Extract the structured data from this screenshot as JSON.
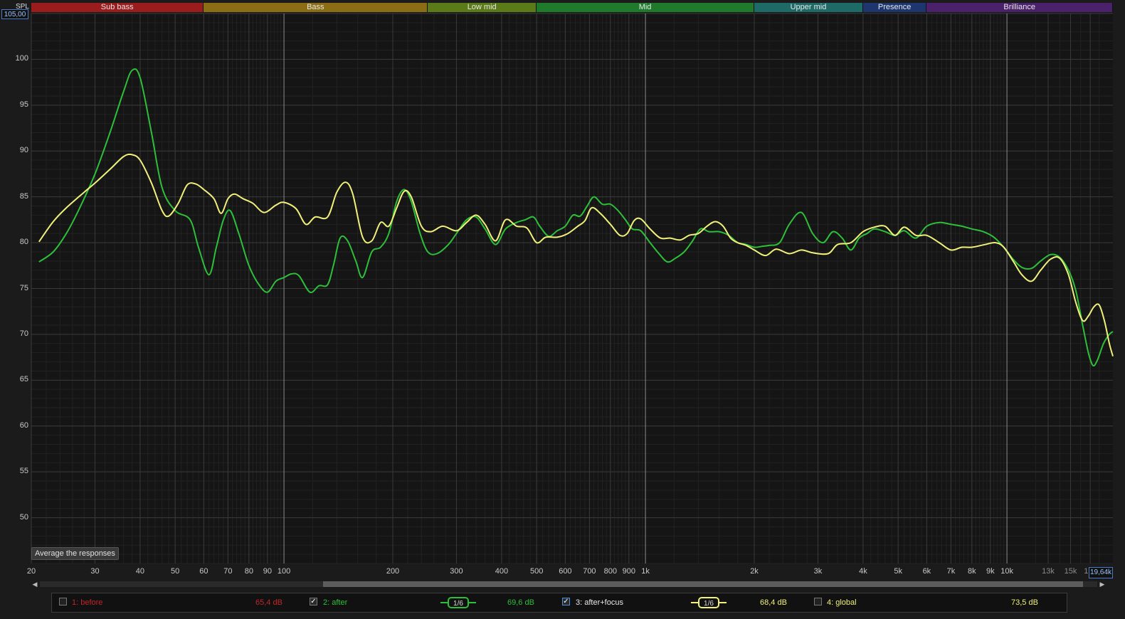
{
  "header": {
    "y_axis_label": "SPL",
    "y_max_value": "105,00"
  },
  "bands": [
    {
      "label": "Sub bass",
      "from": 20,
      "to": 60,
      "color": "#9a1c1c"
    },
    {
      "label": "Bass",
      "from": 60,
      "to": 250,
      "color": "#8a6d14"
    },
    {
      "label": "Low mid",
      "from": 250,
      "to": 500,
      "color": "#5b7a18"
    },
    {
      "label": "Mid",
      "from": 500,
      "to": 2000,
      "color": "#1f7a2b"
    },
    {
      "label": "Upper mid",
      "from": 2000,
      "to": 4000,
      "color": "#1d6a66"
    },
    {
      "label": "Presence",
      "from": 4000,
      "to": 6000,
      "color": "#1d3670"
    },
    {
      "label": "Brilliance",
      "from": 6000,
      "to": 19640,
      "color": "#4a216a"
    }
  ],
  "x_max_value": "19,64k",
  "avg_button_label": "Average the responses",
  "legend": {
    "items": [
      {
        "id": "1",
        "label": "1: before",
        "value": "65,4 dB",
        "color": "#c0262a",
        "checked": false
      },
      {
        "id": "2",
        "label": "2: after",
        "value": "69,6 dB",
        "color": "#2ebf3a",
        "checked": true,
        "smoothing": "1/6"
      },
      {
        "id": "3",
        "label": "3: after+focus",
        "value": "68,4 dB",
        "color": "#f0f07a",
        "checked": true,
        "smoothing": "1/6"
      },
      {
        "id": "4",
        "label": "4: global",
        "value": "73,5 dB",
        "color": "#f0f07a",
        "checked": false
      }
    ]
  },
  "chart_data": {
    "type": "line",
    "xscale": "log",
    "xlim": [
      20,
      19640
    ],
    "ylim": [
      45,
      105
    ],
    "ylabel": "SPL",
    "ytick_labels": [
      "50",
      "55",
      "60",
      "65",
      "70",
      "75",
      "80",
      "85",
      "90",
      "95",
      "100"
    ],
    "xtick_labels": [
      {
        "f": 20,
        "t": "20"
      },
      {
        "f": 30,
        "t": "30"
      },
      {
        "f": 40,
        "t": "40"
      },
      {
        "f": 50,
        "t": "50"
      },
      {
        "f": 60,
        "t": "60"
      },
      {
        "f": 70,
        "t": "70"
      },
      {
        "f": 80,
        "t": "80"
      },
      {
        "f": 90,
        "t": "90"
      },
      {
        "f": 100,
        "t": "100"
      },
      {
        "f": 200,
        "t": "200"
      },
      {
        "f": 300,
        "t": "300"
      },
      {
        "f": 400,
        "t": "400"
      },
      {
        "f": 500,
        "t": "500"
      },
      {
        "f": 600,
        "t": "600"
      },
      {
        "f": 700,
        "t": "700"
      },
      {
        "f": 800,
        "t": "800"
      },
      {
        "f": 900,
        "t": "900"
      },
      {
        "f": 1000,
        "t": "1k"
      },
      {
        "f": 2000,
        "t": "2k"
      },
      {
        "f": 3000,
        "t": "3k"
      },
      {
        "f": 4000,
        "t": "4k"
      },
      {
        "f": 5000,
        "t": "5k"
      },
      {
        "f": 6000,
        "t": "6k"
      },
      {
        "f": 7000,
        "t": "7k"
      },
      {
        "f": 8000,
        "t": "8k"
      },
      {
        "f": 9000,
        "t": "9k"
      },
      {
        "f": 10000,
        "t": "10k"
      },
      {
        "f": 13000,
        "t": "13k"
      },
      {
        "f": 15000,
        "t": "15k"
      },
      {
        "f": 17000,
        "t": "17k"
      }
    ],
    "series": [
      {
        "name": "2: after",
        "color": "#2ebf3a",
        "points": [
          [
            21,
            77.9
          ],
          [
            23,
            79
          ],
          [
            25,
            81
          ],
          [
            27,
            83.5
          ],
          [
            30,
            87.5
          ],
          [
            33,
            92
          ],
          [
            36,
            96.5
          ],
          [
            38,
            98.8
          ],
          [
            40,
            98
          ],
          [
            43,
            92
          ],
          [
            46,
            86
          ],
          [
            50,
            83.5
          ],
          [
            55,
            82.5
          ],
          [
            58,
            79.5
          ],
          [
            62,
            76.5
          ],
          [
            65,
            79.5
          ],
          [
            68,
            82.5
          ],
          [
            71,
            83.5
          ],
          [
            75,
            81
          ],
          [
            80,
            77.5
          ],
          [
            85,
            75.5
          ],
          [
            90,
            74.6
          ],
          [
            95,
            75.8
          ],
          [
            100,
            76.2
          ],
          [
            105,
            76.6
          ],
          [
            110,
            76.4
          ],
          [
            118,
            74.6
          ],
          [
            125,
            75.3
          ],
          [
            132,
            75.4
          ],
          [
            137,
            77.5
          ],
          [
            143,
            80.5
          ],
          [
            150,
            80.2
          ],
          [
            158,
            78
          ],
          [
            165,
            76.2
          ],
          [
            175,
            79
          ],
          [
            185,
            79.5
          ],
          [
            195,
            81
          ],
          [
            205,
            84.5
          ],
          [
            215,
            85.8
          ],
          [
            225,
            84.5
          ],
          [
            238,
            81
          ],
          [
            250,
            79
          ],
          [
            265,
            78.8
          ],
          [
            285,
            79.8
          ],
          [
            300,
            81
          ],
          [
            320,
            82.5
          ],
          [
            340,
            82.8
          ],
          [
            360,
            81.5
          ],
          [
            385,
            79.8
          ],
          [
            410,
            81.5
          ],
          [
            440,
            82.2
          ],
          [
            465,
            82.5
          ],
          [
            490,
            82.8
          ],
          [
            510,
            81.8
          ],
          [
            540,
            80.7
          ],
          [
            570,
            81.3
          ],
          [
            600,
            81.8
          ],
          [
            630,
            83
          ],
          [
            660,
            82.9
          ],
          [
            690,
            84
          ],
          [
            720,
            85
          ],
          [
            760,
            84.2
          ],
          [
            800,
            84.2
          ],
          [
            840,
            83.5
          ],
          [
            880,
            82.5
          ],
          [
            920,
            81.5
          ],
          [
            970,
            81.3
          ],
          [
            1030,
            80
          ],
          [
            1090,
            78.8
          ],
          [
            1150,
            77.9
          ],
          [
            1210,
            78.3
          ],
          [
            1280,
            79
          ],
          [
            1350,
            80.2
          ],
          [
            1420,
            81.5
          ],
          [
            1500,
            81.2
          ],
          [
            1600,
            81.2
          ],
          [
            1700,
            80.8
          ],
          [
            1800,
            80
          ],
          [
            1900,
            79.8
          ],
          [
            2000,
            79.5
          ],
          [
            2100,
            79.6
          ],
          [
            2200,
            79.7
          ],
          [
            2350,
            80
          ],
          [
            2500,
            82
          ],
          [
            2700,
            83.3
          ],
          [
            2900,
            81
          ],
          [
            3100,
            80
          ],
          [
            3300,
            81.2
          ],
          [
            3500,
            80.5
          ],
          [
            3700,
            79.2
          ],
          [
            3900,
            80.5
          ],
          [
            4100,
            81
          ],
          [
            4300,
            81.5
          ],
          [
            4600,
            81.2
          ],
          [
            4900,
            80.8
          ],
          [
            5200,
            81.3
          ],
          [
            5600,
            80.5
          ],
          [
            6000,
            81.8
          ],
          [
            6500,
            82.2
          ],
          [
            7000,
            82
          ],
          [
            7500,
            81.8
          ],
          [
            8000,
            81.5
          ],
          [
            8600,
            81.2
          ],
          [
            9200,
            80.6
          ],
          [
            9800,
            79.5
          ],
          [
            10400,
            78.2
          ],
          [
            11000,
            77.3
          ],
          [
            11700,
            77.2
          ],
          [
            12400,
            78
          ],
          [
            13200,
            78.7
          ],
          [
            14000,
            78.4
          ],
          [
            14800,
            77
          ],
          [
            15500,
            74.8
          ],
          [
            16200,
            71
          ],
          [
            16800,
            68
          ],
          [
            17300,
            66.6
          ],
          [
            17800,
            67.2
          ],
          [
            18500,
            69
          ],
          [
            19200,
            70
          ],
          [
            19640,
            70.3
          ]
        ]
      },
      {
        "name": "3: after+focus",
        "color": "#f0f07a",
        "points": [
          [
            21,
            80.1
          ],
          [
            23,
            82.3
          ],
          [
            25,
            83.8
          ],
          [
            28,
            85.5
          ],
          [
            30,
            86.5
          ],
          [
            33,
            88
          ],
          [
            36,
            89.4
          ],
          [
            38,
            89.6
          ],
          [
            40,
            89
          ],
          [
            43,
            86.5
          ],
          [
            46,
            83.5
          ],
          [
            48,
            82.9
          ],
          [
            51,
            84.3
          ],
          [
            54,
            86.3
          ],
          [
            57,
            86.4
          ],
          [
            60,
            85.8
          ],
          [
            64,
            84.8
          ],
          [
            67,
            83.2
          ],
          [
            70,
            84.8
          ],
          [
            73,
            85.3
          ],
          [
            77,
            84.8
          ],
          [
            82,
            84.3
          ],
          [
            88,
            83.3
          ],
          [
            95,
            84.1
          ],
          [
            100,
            84.4
          ],
          [
            108,
            83.7
          ],
          [
            115,
            82
          ],
          [
            122,
            82.8
          ],
          [
            132,
            82.8
          ],
          [
            140,
            85.5
          ],
          [
            148,
            86.6
          ],
          [
            155,
            85.3
          ],
          [
            165,
            80.6
          ],
          [
            175,
            80.2
          ],
          [
            185,
            82.2
          ],
          [
            195,
            81.8
          ],
          [
            205,
            83.8
          ],
          [
            215,
            85.6
          ],
          [
            225,
            85
          ],
          [
            240,
            81.8
          ],
          [
            255,
            81.2
          ],
          [
            275,
            81.8
          ],
          [
            300,
            81.3
          ],
          [
            320,
            82.2
          ],
          [
            340,
            83
          ],
          [
            360,
            82
          ],
          [
            385,
            80.2
          ],
          [
            410,
            82.5
          ],
          [
            440,
            81.8
          ],
          [
            470,
            81.6
          ],
          [
            500,
            80
          ],
          [
            530,
            80.6
          ],
          [
            570,
            80.6
          ],
          [
            610,
            81
          ],
          [
            650,
            81.8
          ],
          [
            680,
            82.4
          ],
          [
            710,
            83.8
          ],
          [
            750,
            83.2
          ],
          [
            800,
            82
          ],
          [
            850,
            80.8
          ],
          [
            890,
            81
          ],
          [
            930,
            82.4
          ],
          [
            970,
            82.6
          ],
          [
            1030,
            81.5
          ],
          [
            1100,
            80.5
          ],
          [
            1170,
            80.5
          ],
          [
            1250,
            80.3
          ],
          [
            1320,
            80.8
          ],
          [
            1400,
            81
          ],
          [
            1480,
            81.8
          ],
          [
            1560,
            82.3
          ],
          [
            1640,
            81.8
          ],
          [
            1720,
            80.5
          ],
          [
            1800,
            80
          ],
          [
            1900,
            79.7
          ],
          [
            2000,
            79.2
          ],
          [
            2150,
            78.6
          ],
          [
            2300,
            79.3
          ],
          [
            2500,
            78.8
          ],
          [
            2700,
            79.2
          ],
          [
            2900,
            78.9
          ],
          [
            3200,
            78.8
          ],
          [
            3400,
            79.8
          ],
          [
            3700,
            80
          ],
          [
            4000,
            81.2
          ],
          [
            4300,
            81.7
          ],
          [
            4600,
            81.8
          ],
          [
            4900,
            80.8
          ],
          [
            5200,
            81.7
          ],
          [
            5600,
            80.8
          ],
          [
            6000,
            80.8
          ],
          [
            6500,
            80
          ],
          [
            7000,
            79.2
          ],
          [
            7500,
            79.5
          ],
          [
            8000,
            79.5
          ],
          [
            8700,
            79.8
          ],
          [
            9300,
            80
          ],
          [
            9800,
            79.5
          ],
          [
            10400,
            78
          ],
          [
            11000,
            76.5
          ],
          [
            11700,
            75.8
          ],
          [
            12400,
            77
          ],
          [
            13200,
            78.2
          ],
          [
            14000,
            78.3
          ],
          [
            14800,
            76.5
          ],
          [
            15500,
            73.5
          ],
          [
            16200,
            71.5
          ],
          [
            16800,
            72
          ],
          [
            17400,
            73
          ],
          [
            18000,
            73.2
          ],
          [
            18600,
            71.5
          ],
          [
            19200,
            69
          ],
          [
            19640,
            67.6
          ]
        ]
      }
    ]
  }
}
